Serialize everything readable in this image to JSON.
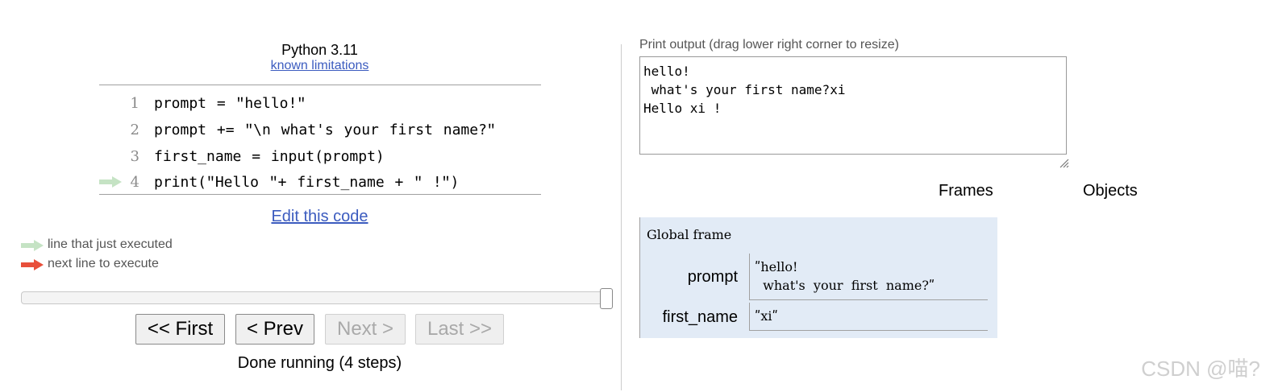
{
  "header": {
    "language": "Python 3.11",
    "limitations_link": "known limitations"
  },
  "code": {
    "lines": [
      {
        "num": "1",
        "text": "prompt = ʺhello!ʺ",
        "arrow": "none"
      },
      {
        "num": "2",
        "text": "prompt += ʺ\\n what's your first name?ʺ",
        "arrow": "none"
      },
      {
        "num": "3",
        "text": "first_name = input(prompt)",
        "arrow": "none"
      },
      {
        "num": "4",
        "text": "print(ʺHello ʺ+ first_name + ʺ !ʺ)",
        "arrow": "just-executed"
      }
    ],
    "edit_link": "Edit this code"
  },
  "legend": {
    "just_executed": "line that just executed",
    "next_line": "next line to execute"
  },
  "colors": {
    "just_executed_arrow": "#c5e3c4",
    "next_line_arrow": "#e84f3a",
    "link": "#3b5bbf",
    "frame_bg": "#e2ebf6"
  },
  "navigation": {
    "progress": 1.0,
    "first_label": "<< First",
    "prev_label": "< Prev",
    "next_label": "Next >",
    "last_label": "Last >>",
    "status": "Done running (4 steps)"
  },
  "output": {
    "label": "Print output (drag lower right corner to resize)",
    "text": "hello!\n what's your first name?xi\nHello xi !"
  },
  "visualization": {
    "frames_heading": "Frames",
    "objects_heading": "Objects",
    "frame_title": "Global frame",
    "variables": [
      {
        "name": "prompt",
        "value": "ʺhello!\n  what's  your  first  name?ʺ"
      },
      {
        "name": "first_name",
        "value": "ʺxiʺ"
      }
    ]
  },
  "watermark": "CSDN @喵?"
}
